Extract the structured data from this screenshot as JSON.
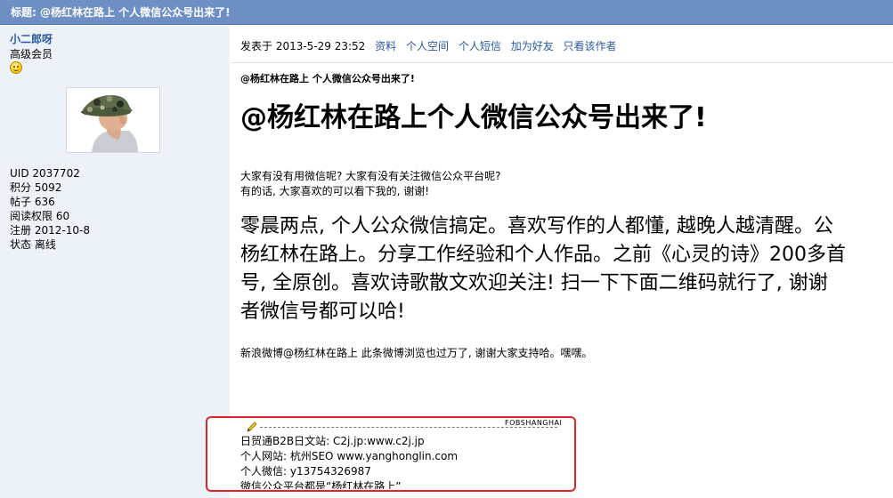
{
  "title_bar": {
    "text": "标题: @杨红林在路上 个人微信公众号出来了!"
  },
  "user": {
    "name": "小二郎呀",
    "level": "高级会员",
    "stats": [
      {
        "label": "UID",
        "value": "2037702"
      },
      {
        "label": "积分",
        "value": "5092"
      },
      {
        "label": "帖子",
        "value": "636"
      },
      {
        "label": "阅读权限",
        "value": "60"
      },
      {
        "label": "注册",
        "value": "2012-10-8"
      },
      {
        "label": "状态",
        "value": "离线"
      }
    ]
  },
  "post_meta": {
    "posted_at": "发表于 2013-5-29 23:52",
    "links": [
      "资料",
      "个人空间",
      "个人短信",
      "加为好友",
      "只看该作者"
    ]
  },
  "post": {
    "small_title": "@杨红林在路上 个人微信公众号出来了!",
    "big_title": "@杨红林在路上个人微信公众号出来了!",
    "intro_lines": [
      "大家有没有用微信呢? 大家有没有关注微信公众平台呢?",
      "有的话, 大家喜欢的可以看下我的, 谢谢!"
    ],
    "large_lines": [
      "零晨两点, 个人公众微信搞定。喜欢写作的人都懂, 越晚人越清醒。公",
      "杨红林在路上。分享工作经验和个人作品。之前《心灵的诗》200多首",
      "号, 全原创。喜欢诗歌散文欢迎关注! 扫一下下面二维码就行了, 谢谢",
      "者微信号都可以哈!"
    ],
    "weibo_line": "新浪微博@杨红林在路上 此条微博浏览也过万了, 谢谢大家支持哈。嘿嘿。"
  },
  "signature": {
    "brand": "FOBSHANGHAI",
    "lines": [
      "日贸通B2B日文站: C2j.jp:www.c2j.jp",
      "个人网站: 杭州SEO www.yanghonglin.com",
      "个人微信: y13754326987",
      "微信公众平台都是“杨红林在路上”"
    ]
  },
  "icons": {
    "smiley": "smiley-icon",
    "pencil": "pencil-icon"
  },
  "colors": {
    "title_bar": "#6d8fc4",
    "sidebar": "#ecf2f8",
    "link": "#2b5a9e",
    "highlight_box": "#e0262b"
  }
}
